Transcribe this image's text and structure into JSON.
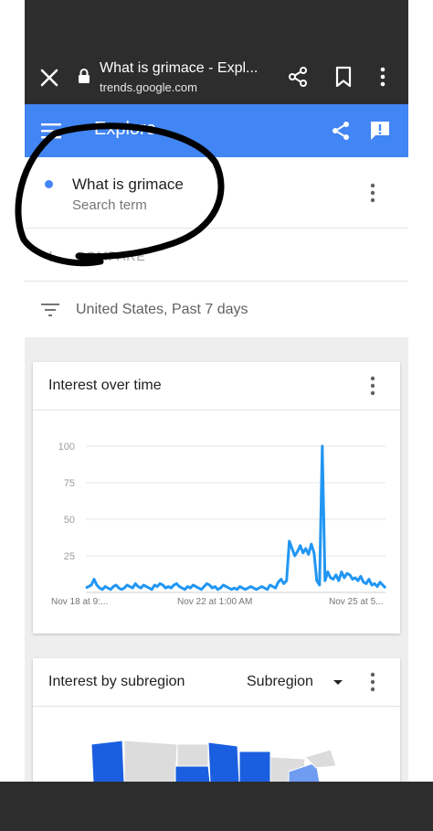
{
  "browser": {
    "page_title": "What is grimace - Expl...",
    "url": "trends.google.com"
  },
  "app": {
    "title": "Explore"
  },
  "search_term": {
    "name": "What is grimace",
    "label": "Search term",
    "color": "#4285f4"
  },
  "compare": {
    "label": "COMPARE"
  },
  "filter": {
    "text": "United States, Past 7 days"
  },
  "interest_over_time": {
    "title": "Interest over time"
  },
  "interest_by_subregion": {
    "title": "Interest by subregion",
    "dropdown_value": "Subregion"
  },
  "colors": {
    "accent": "#4285f4",
    "chart_line": "#2196f3",
    "dark_chrome": "#2d2d2d",
    "map_dark": "#1a5fe0",
    "map_light": "#6f9bf0",
    "map_grey": "#dcdcdc"
  },
  "chart_data": {
    "type": "line",
    "title": "Interest over time",
    "xlabel": "",
    "ylabel": "",
    "ylim": [
      0,
      100
    ],
    "yticks": [
      100,
      75,
      50,
      25
    ],
    "xtick_labels": [
      "Nov 18 at 9:...",
      "Nov 22 at 1:00 AM",
      "Nov 25 at 5..."
    ],
    "grid": true,
    "series": [
      {
        "values": [
          3,
          4,
          5,
          9,
          5,
          3,
          2,
          4,
          3,
          2,
          4,
          5,
          3,
          2,
          3,
          5,
          4,
          3,
          6,
          4,
          3,
          5,
          4,
          3,
          2,
          5,
          4,
          6,
          5,
          3,
          4,
          3,
          5,
          6,
          4,
          3,
          2,
          4,
          3,
          5,
          4,
          3,
          2,
          4,
          6,
          5,
          3,
          4,
          2,
          3,
          5,
          4,
          3,
          2,
          3,
          2,
          4,
          3,
          2,
          3,
          4,
          3,
          2,
          3,
          4,
          3,
          2,
          5,
          4,
          3,
          7,
          9,
          6,
          8,
          35,
          30,
          25,
          28,
          32,
          27,
          30,
          26,
          33,
          27,
          8,
          5,
          100,
          8,
          14,
          10,
          9,
          12,
          8,
          14,
          10,
          13,
          12,
          9,
          10,
          8,
          11,
          7,
          6,
          9,
          5,
          6,
          4,
          7,
          5,
          3
        ]
      }
    ]
  }
}
